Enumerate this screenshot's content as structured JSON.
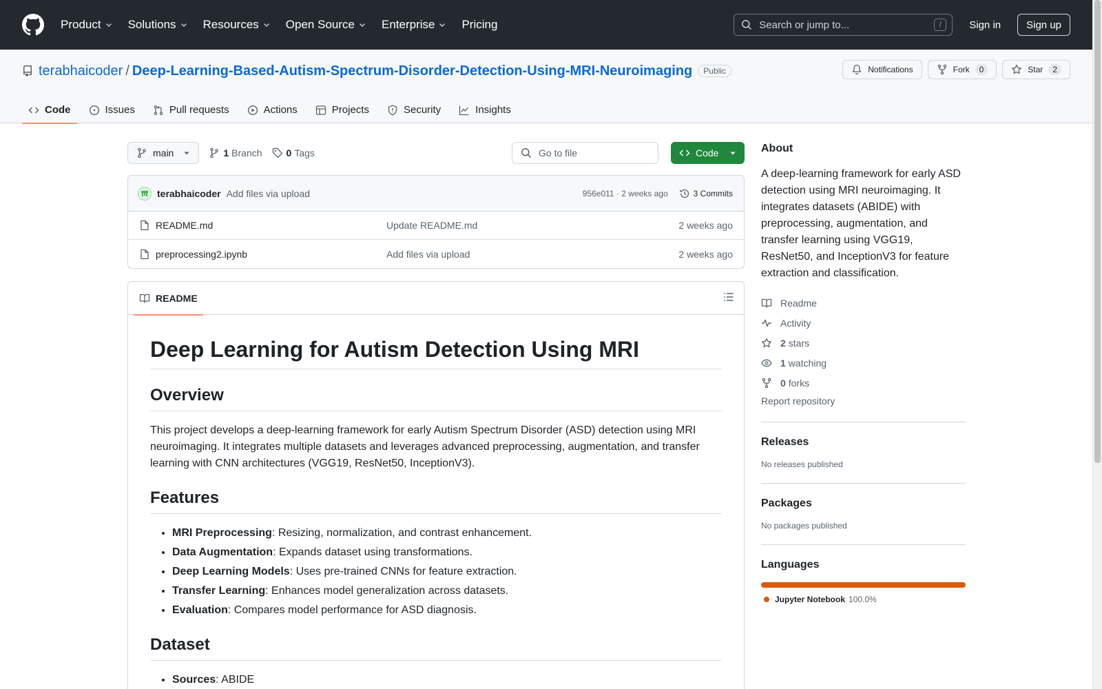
{
  "header": {
    "nav": [
      "Product",
      "Solutions",
      "Resources",
      "Open Source",
      "Enterprise",
      "Pricing"
    ],
    "search_placeholder": "Search or jump to...",
    "search_shortcut": "/",
    "sign_in": "Sign in",
    "sign_up": "Sign up"
  },
  "repo": {
    "owner": "terabhaicoder",
    "separator": "/",
    "name": "Deep-Learning-Based-Autism-Spectrum-Disorder-Detection-Using-MRI-Neuroimaging",
    "visibility": "Public",
    "notifications_label": "Notifications",
    "fork_label": "Fork",
    "fork_count": "0",
    "star_label": "Star",
    "star_count": "2"
  },
  "tabs": [
    "Code",
    "Issues",
    "Pull requests",
    "Actions",
    "Projects",
    "Security",
    "Insights"
  ],
  "toolbar": {
    "branch": "main",
    "branch_count": "1",
    "branch_label": "Branch",
    "tag_count": "0",
    "tag_label": "Tags",
    "goto_placeholder": "Go to file",
    "code_button": "Code"
  },
  "commit": {
    "author": "terabhaicoder",
    "message": "Add files via upload",
    "hash_time": "956e011 · 2 weeks ago",
    "commits": "3 Commits"
  },
  "files": [
    {
      "name": "README.md",
      "message": "Update README.md",
      "date": "2 weeks ago"
    },
    {
      "name": "preprocessing2.ipynb",
      "message": "Add files via upload",
      "date": "2 weeks ago"
    }
  ],
  "readme": {
    "tab": "README",
    "title": "Deep Learning for Autism Detection Using MRI",
    "overview_heading": "Overview",
    "overview_text": "This project develops a deep-learning framework for early Autism Spectrum Disorder (ASD) detection using MRI neuroimaging. It integrates multiple datasets and leverages advanced preprocessing, augmentation, and transfer learning with CNN architectures (VGG19, ResNet50, InceptionV3).",
    "features_heading": "Features",
    "features": [
      {
        "bold": "MRI Preprocessing",
        "text": ": Resizing, normalization, and contrast enhancement."
      },
      {
        "bold": "Data Augmentation",
        "text": ": Expands dataset using transformations."
      },
      {
        "bold": "Deep Learning Models",
        "text": ": Uses pre-trained CNNs for feature extraction."
      },
      {
        "bold": "Transfer Learning",
        "text": ": Enhances model generalization across datasets."
      },
      {
        "bold": "Evaluation",
        "text": ": Compares model performance for ASD diagnosis."
      }
    ],
    "dataset_heading": "Dataset",
    "dataset_items": [
      {
        "bold": "Sources",
        "text": ": ABIDE"
      }
    ]
  },
  "sidebar": {
    "about_heading": "About",
    "about_text": "A deep-learning framework for early ASD detection using MRI neuroimaging. It integrates datasets (ABIDE) with preprocessing, augmentation, and transfer learning using VGG19, ResNet50, and InceptionV3 for feature extraction and classification.",
    "readme": "Readme",
    "activity": "Activity",
    "stars_count": "2",
    "stars_label": "stars",
    "watching_count": "1",
    "watching_label": "watching",
    "forks_count": "0",
    "forks_label": "forks",
    "report": "Report repository",
    "releases_heading": "Releases",
    "releases_text": "No releases published",
    "packages_heading": "Packages",
    "packages_text": "No packages published",
    "languages_heading": "Languages",
    "language_name": "Jupyter Notebook",
    "language_pct": "100.0%",
    "language_color": "#DA5B0B"
  },
  "colors": {
    "header_bg": "#24292f",
    "link": "#0969da",
    "code_button": "#1f883d",
    "tab_underline": "#fd8c73"
  }
}
